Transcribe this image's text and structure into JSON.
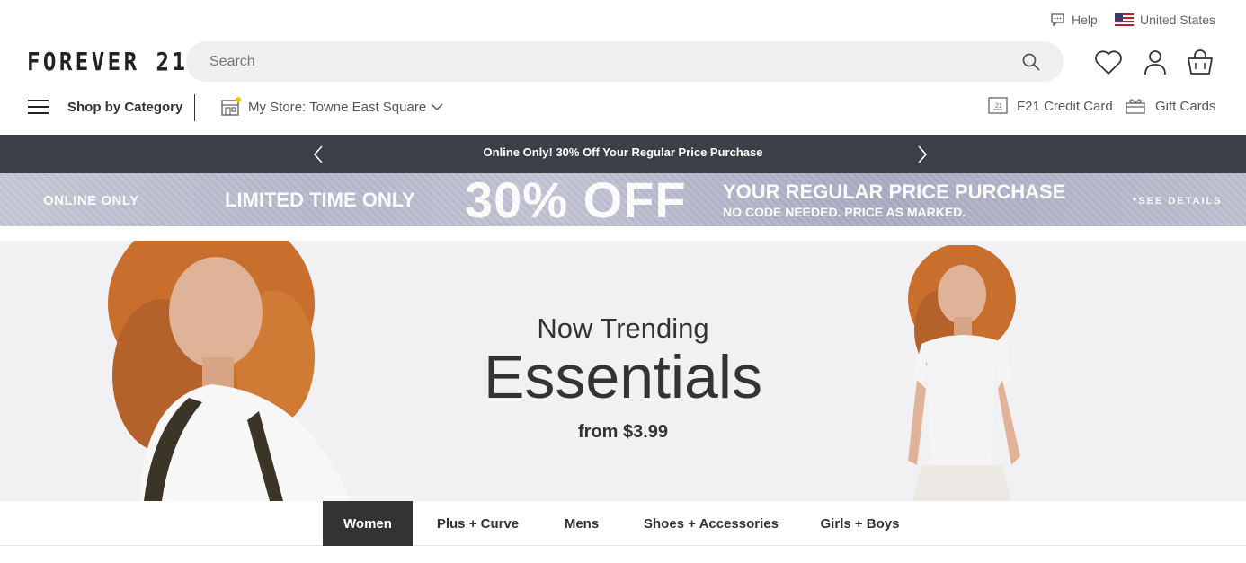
{
  "utility": {
    "help_label": "Help",
    "country_label": "United States"
  },
  "header": {
    "logo": "FOREVER 21",
    "search_placeholder": "Search"
  },
  "subnav": {
    "shop_by_category": "Shop by Category",
    "my_store": "My Store: Towne East Square",
    "credit_card": "F21 Credit Card",
    "gift_cards": "Gift Cards"
  },
  "promo": {
    "text": "Online Only! 30% Off Your Regular Price Purchase"
  },
  "banner": {
    "online_only": "ONLINE ONLY",
    "limited": "LIMITED TIME ONLY",
    "headline": "30% OFF",
    "regular": "YOUR REGULAR PRICE PURCHASE",
    "no_code": "NO CODE NEEDED. PRICE AS MARKED.",
    "see_details": "*SEE DETAILS"
  },
  "hero": {
    "kicker": "Now Trending",
    "title": "Essentials",
    "price": "from $3.99"
  },
  "tabs": [
    {
      "label": "Women",
      "active": true
    },
    {
      "label": "Plus + Curve",
      "active": false
    },
    {
      "label": "Mens",
      "active": false
    },
    {
      "label": "Shoes + Accessories",
      "active": false
    },
    {
      "label": "Girls + Boys",
      "active": false
    }
  ],
  "colors": {
    "dark_bar": "#3d3f47",
    "active_tab": "#333333",
    "store_dot": "#f5c400",
    "hero_bg": "#f1f1f3"
  }
}
